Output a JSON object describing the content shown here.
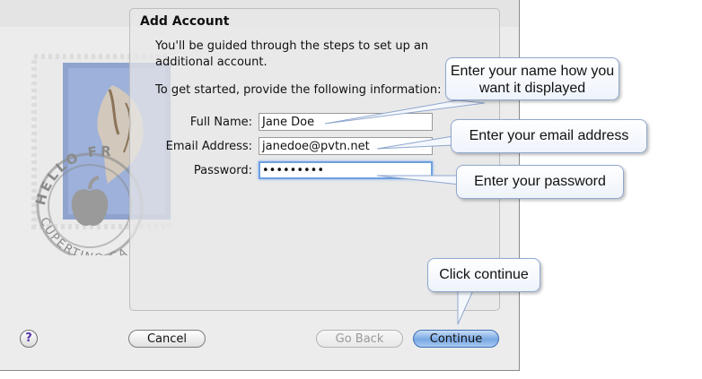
{
  "dialog": {
    "title": "Add Account",
    "description": "You'll be guided through the steps to set up an additional account.",
    "intro": "To get started, provide the following information:",
    "fields": {
      "full_name_label": "Full Name:",
      "full_name_value": "Jane Doe",
      "email_label": "Email Address:",
      "email_value": "janedoe@pvtn.net",
      "password_label": "Password:",
      "password_value": "•••••••••"
    },
    "buttons": {
      "help": "?",
      "cancel": "Cancel",
      "go_back": "Go Back",
      "continue": "Continue"
    }
  },
  "callouts": {
    "name": "Enter your name how you want it displayed",
    "email": "Enter your email address",
    "password": "Enter your password",
    "continue": "Click continue"
  },
  "stamp": {
    "text_top": "HELLO FR",
    "text_bottom": "CUPERTINO CA"
  },
  "colors": {
    "accent": "#78a8e3",
    "focus_ring": "#6e9fe0",
    "callout_border": "#8fa7cf"
  },
  "icons": [
    "stamp-icon",
    "apple-logo-icon",
    "eagle-icon",
    "help-icon"
  ]
}
